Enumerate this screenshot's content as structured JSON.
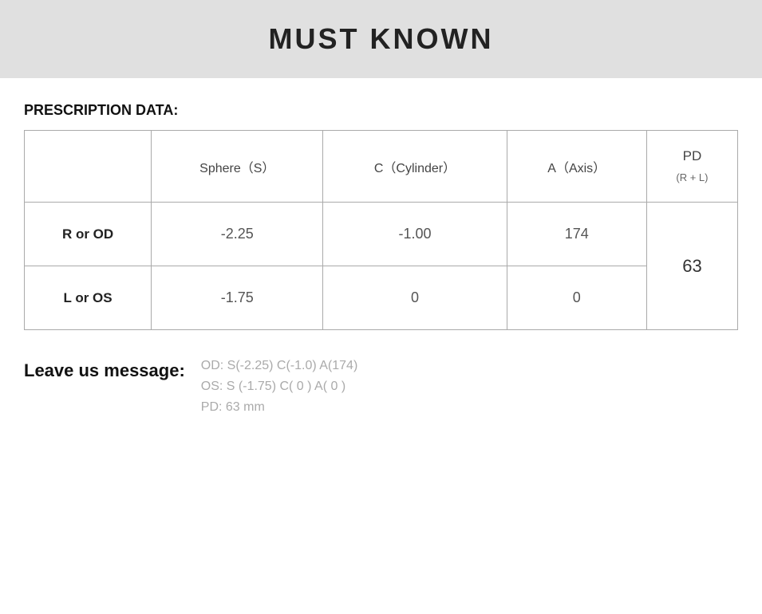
{
  "header": {
    "title": "MUST KNOWN"
  },
  "section": {
    "prescription_label": "PRESCRIPTION DATA:"
  },
  "table": {
    "headers": {
      "row_label": "",
      "sphere": "Sphere（S）",
      "cylinder": "C（Cylinder）",
      "axis": "A（Axis）",
      "pd_label": "PD",
      "pd_sub": "(R + L)"
    },
    "rows": [
      {
        "label": "R or OD",
        "sphere": "-2.25",
        "cylinder": "-1.00",
        "axis": "174"
      },
      {
        "label": "L or OS",
        "sphere": "-1.75",
        "cylinder": "0",
        "axis": "0"
      }
    ],
    "pd_value": "63"
  },
  "leave_message": {
    "label": "Leave us message:",
    "lines": [
      "OD:  S(-2.25)    C(-1.0)   A(174)",
      "OS:  S (-1.75)    C( 0 )     A( 0 )",
      "PD:  63 mm"
    ]
  }
}
